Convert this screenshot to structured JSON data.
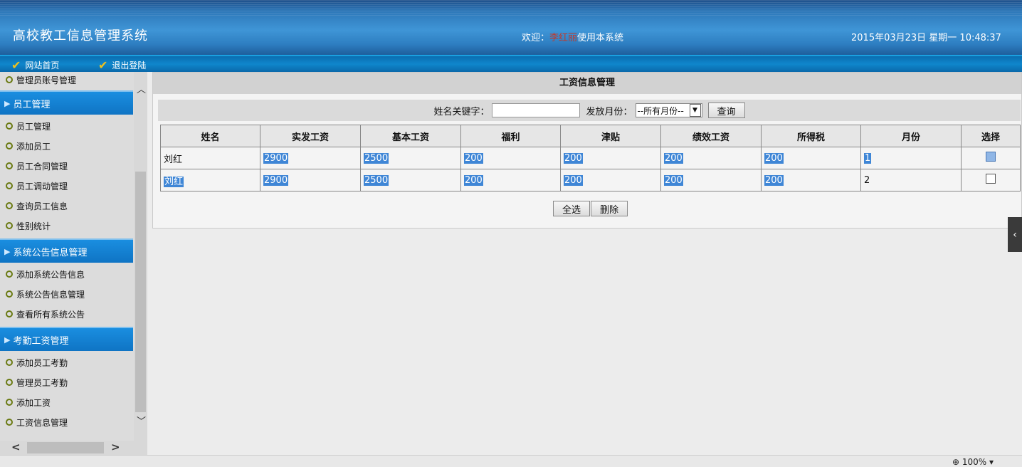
{
  "header": {
    "app_title": "高校教工信息管理系统",
    "welcome_prefix": "欢迎：",
    "user_name": "李红丽",
    "welcome_suffix": "使用本系统",
    "datetime": "2015年03月23日 星期一 10:48:37"
  },
  "nav": {
    "home": "网站首页",
    "logout": "退出登陆"
  },
  "sidebar": {
    "top_item": "管理员账号管理",
    "groups": [
      {
        "title": "员工管理",
        "items": [
          "员工管理",
          "添加员工",
          "员工合同管理",
          "员工调动管理",
          "查询员工信息",
          "性别统计"
        ]
      },
      {
        "title": "系统公告信息管理",
        "items": [
          "添加系统公告信息",
          "系统公告信息管理",
          "查看所有系统公告"
        ]
      },
      {
        "title": "考勤工资管理",
        "items": [
          "添加员工考勤",
          "管理员工考勤",
          "添加工资",
          "工资信息管理"
        ]
      }
    ]
  },
  "main": {
    "section_title": "工资信息管理",
    "search": {
      "name_label": "姓名关键字：",
      "name_value": "",
      "month_label": "发放月份：",
      "month_selected": "--所有月份--",
      "query_button": "查询"
    },
    "table": {
      "headers": [
        "姓名",
        "实发工资",
        "基本工资",
        "福利",
        "津贴",
        "绩效工资",
        "所得税",
        "月份",
        "选择"
      ],
      "rows": [
        {
          "name": "刘红",
          "actual": "2900",
          "base": "2500",
          "welfare": "200",
          "allowance": "200",
          "performance": "200",
          "tax": "200",
          "month": "1",
          "checked": true
        },
        {
          "name": "刘红",
          "actual": "2900",
          "base": "2500",
          "welfare": "200",
          "allowance": "200",
          "performance": "200",
          "tax": "200",
          "month": "2",
          "checked": false
        }
      ]
    },
    "select_all_button": "全选",
    "delete_button": "删除"
  },
  "statusbar": {
    "zoom": "100%"
  },
  "colors": {
    "header_blue": "#2d77b8",
    "nav_blue": "#0f86cc",
    "sidebar_head": "#1a8ee0",
    "selection": "#3f86d6",
    "username_red": "#c0392b"
  }
}
